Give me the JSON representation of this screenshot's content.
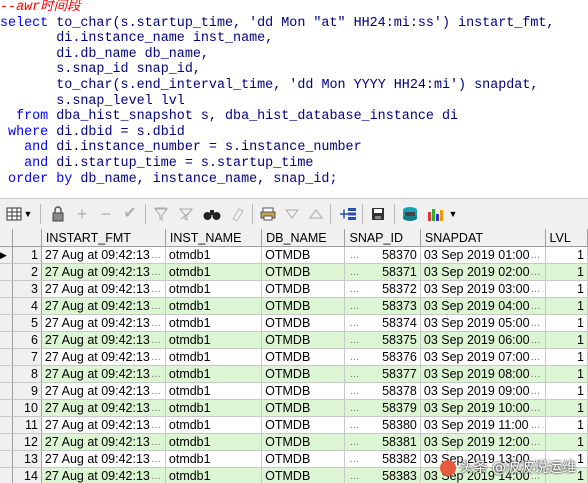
{
  "editor": {
    "comment": "--awr时间段",
    "lines": [
      {
        "kw": "select ",
        "rest": "to_char(s.startup_time, ",
        "str": "'dd Mon \"at\" HH24:mi:ss'",
        "tail": ") instart_fmt,"
      },
      {
        "text": "       di.instance_name inst_name,"
      },
      {
        "text": "       di.db_name db_name,"
      },
      {
        "text": "       s.snap_id snap_id,"
      },
      {
        "rest": "       to_char(s.end_interval_time, ",
        "str": "'dd Mon YYYY HH24:mi'",
        "tail": ") snapdat,"
      },
      {
        "text": "       s.snap_level lvl"
      },
      {
        "kw": "  from ",
        "rest": "dba_hist_snapshot s, dba_hist_database_instance di"
      },
      {
        "kw": " where ",
        "rest": "di.dbid = s.dbid"
      },
      {
        "kw": "   and ",
        "rest": "di.instance_number = s.instance_number"
      },
      {
        "kw": "   and ",
        "rest": "di.startup_time = s.startup_time"
      },
      {
        "kw": " order by ",
        "rest": "db_name, instance_name, snap_id;"
      }
    ]
  },
  "grid": {
    "columns": [
      "INSTART_FMT",
      "INST_NAME",
      "DB_NAME",
      "SNAP_ID",
      "SNAPDAT",
      "LVL"
    ],
    "rows": [
      [
        "27 Aug at 09:42:13",
        "otmdb1",
        "OTMDB",
        "58370",
        "03 Sep 2019 01:00",
        "1"
      ],
      [
        "27 Aug at 09:42:13",
        "otmdb1",
        "OTMDB",
        "58371",
        "03 Sep 2019 02:00",
        "1"
      ],
      [
        "27 Aug at 09:42:13",
        "otmdb1",
        "OTMDB",
        "58372",
        "03 Sep 2019 03:00",
        "1"
      ],
      [
        "27 Aug at 09:42:13",
        "otmdb1",
        "OTMDB",
        "58373",
        "03 Sep 2019 04:00",
        "1"
      ],
      [
        "27 Aug at 09:42:13",
        "otmdb1",
        "OTMDB",
        "58374",
        "03 Sep 2019 05:00",
        "1"
      ],
      [
        "27 Aug at 09:42:13",
        "otmdb1",
        "OTMDB",
        "58375",
        "03 Sep 2019 06:00",
        "1"
      ],
      [
        "27 Aug at 09:42:13",
        "otmdb1",
        "OTMDB",
        "58376",
        "03 Sep 2019 07:00",
        "1"
      ],
      [
        "27 Aug at 09:42:13",
        "otmdb1",
        "OTMDB",
        "58377",
        "03 Sep 2019 08:00",
        "1"
      ],
      [
        "27 Aug at 09:42:13",
        "otmdb1",
        "OTMDB",
        "58378",
        "03 Sep 2019 09:00",
        "1"
      ],
      [
        "27 Aug at 09:42:13",
        "otmdb1",
        "OTMDB",
        "58379",
        "03 Sep 2019 10:00",
        "1"
      ],
      [
        "27 Aug at 09:42:13",
        "otmdb1",
        "OTMDB",
        "58380",
        "03 Sep 2019 11:00",
        "1"
      ],
      [
        "27 Aug at 09:42:13",
        "otmdb1",
        "OTMDB",
        "58381",
        "03 Sep 2019 12:00",
        "1"
      ],
      [
        "27 Aug at 09:42:13",
        "otmdb1",
        "OTMDB",
        "58382",
        "03 Sep 2019 13:00",
        "1"
      ],
      [
        "27 Aug at 09:42:13",
        "otmdb1",
        "OTMDB",
        "58383",
        "03 Sep 2019 14:00",
        "1"
      ]
    ],
    "row_numbers": [
      "1",
      "2",
      "3",
      "4",
      "5",
      "6",
      "7",
      "8",
      "9",
      "10",
      "11",
      "12",
      "13",
      "14"
    ],
    "current_row_marker": "▶",
    "cell_button": "…",
    "alt_row_color": "#dcf5d2"
  },
  "toolbar": {
    "icons": [
      "grid-menu-icon",
      "lock-icon",
      "add-record-icon",
      "delete-record-icon",
      "post-icon",
      "filter-icon",
      "clear-filter-icon",
      "find-icon",
      "clear-icon",
      "print-icon",
      "next-icon",
      "prev-icon",
      "query-by-example-icon",
      "save-icon",
      "export-icon",
      "chart-icon"
    ]
  },
  "watermark": "头条 @波波说运维"
}
